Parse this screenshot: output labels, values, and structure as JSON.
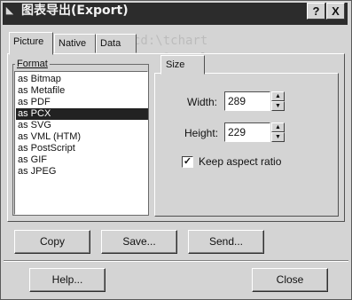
{
  "window": {
    "title": "图表导出(Export)",
    "title_icon": "app-icon",
    "help_button": "?",
    "close_button": "X"
  },
  "tabs": [
    "Picture",
    "Native",
    "Data"
  ],
  "format": {
    "label": "Format",
    "items": [
      "as Bitmap",
      "as Metafile",
      "as PDF",
      "as PCX",
      "as SVG",
      "as VML (HTM)",
      "as PostScript",
      "as GIF",
      "as JPEG"
    ],
    "selected": "as PCX"
  },
  "size": {
    "tab": "Size",
    "width_label": "Width:",
    "width_value": "289",
    "height_label": "Height:",
    "height_value": "229",
    "keep_aspect_label": "Keep aspect ratio",
    "keep_aspect_checked": true
  },
  "actions": {
    "copy": "Copy",
    "save": "Save...",
    "send": "Send...",
    "help": "Help...",
    "close": "Close"
  }
}
